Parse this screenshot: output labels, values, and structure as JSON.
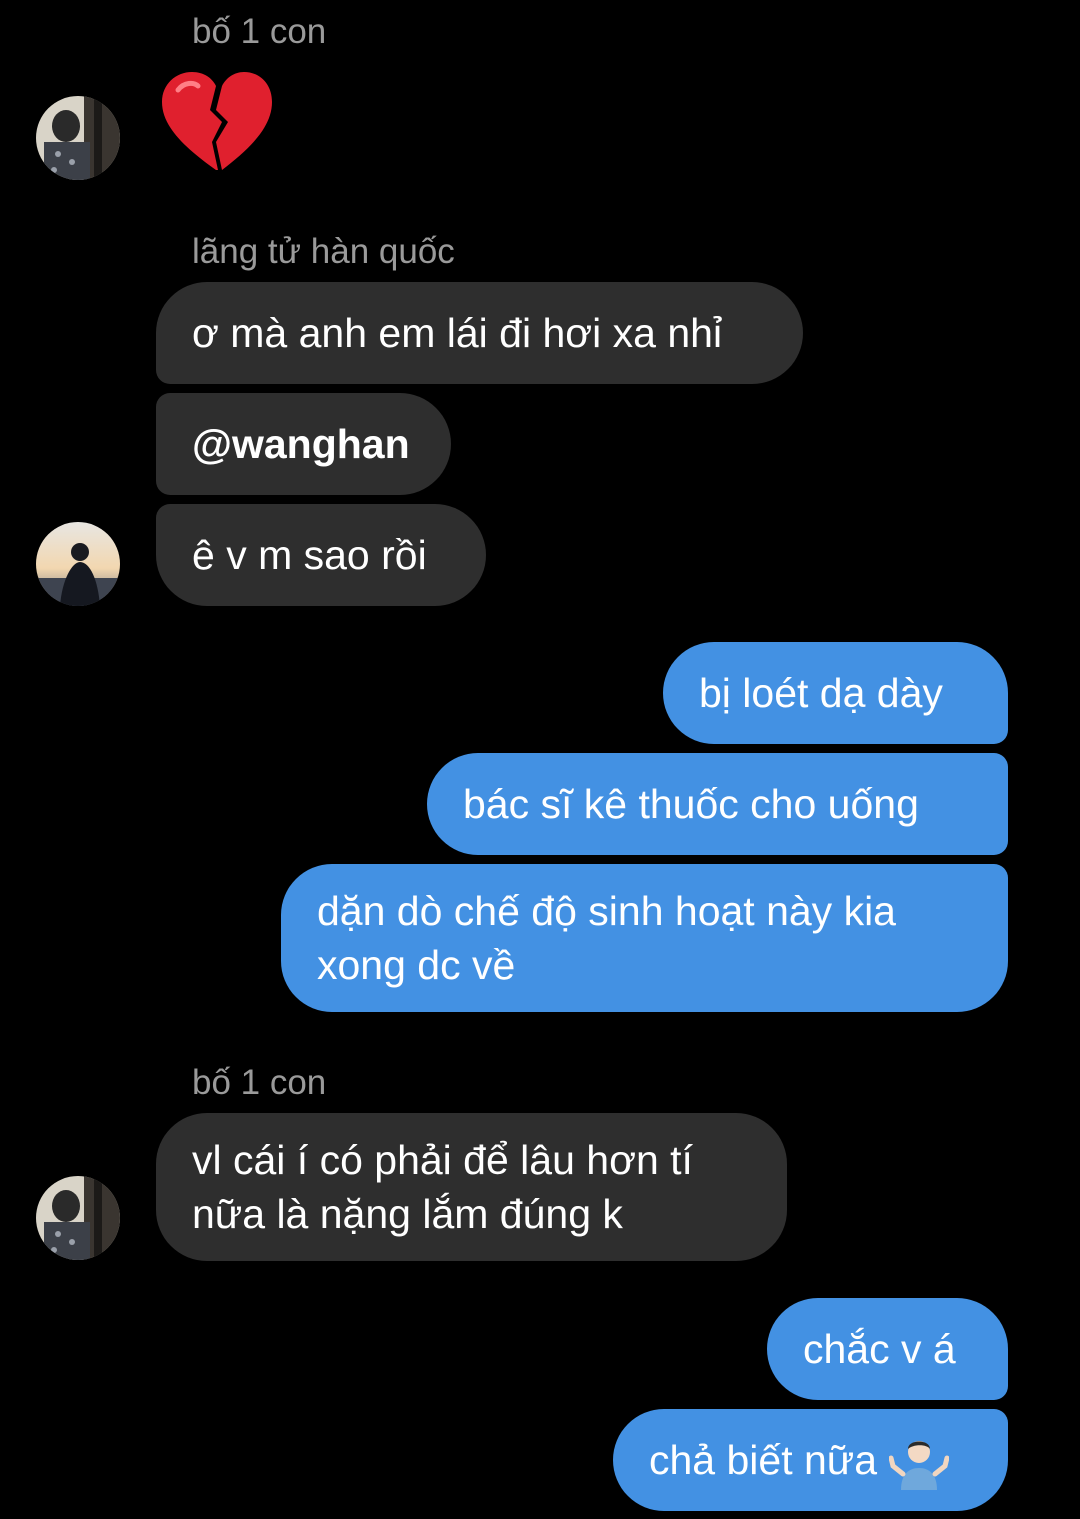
{
  "conversation": {
    "groups": [
      {
        "sender": "bố 1 con",
        "messages": [
          {
            "type": "emoji",
            "icon": "broken-heart-icon"
          }
        ]
      },
      {
        "sender": "lãng tử hàn quốc",
        "messages": [
          {
            "text": "ơ mà anh em lái đi hơi xa nhỉ"
          },
          {
            "text": "@wanghan"
          },
          {
            "text": "ê v m sao rồi"
          }
        ]
      },
      {
        "sender": "",
        "outgoing": true,
        "messages": [
          {
            "text": "bị loét dạ dày"
          },
          {
            "text": "bác sĩ kê thuốc cho uống"
          },
          {
            "line1": "dặn dò chế độ sinh hoạt này kia",
            "line2": "xong dc về"
          }
        ]
      },
      {
        "sender": "bố 1 con",
        "messages": [
          {
            "line1": "vl cái í có phải để lâu hơn tí",
            "line2": "nữa là nặng lắm đúng k"
          }
        ]
      },
      {
        "sender": "",
        "outgoing": true,
        "messages": [
          {
            "text": "chắc v á"
          },
          {
            "text": "chả biết nữa",
            "icon": "person-shrugging-icon"
          }
        ]
      }
    ]
  },
  "colors": {
    "background": "#000000",
    "incoming_bubble": "#2e2e2e",
    "outgoing_bubble": "#4391e3",
    "sender_name": "#9a9a9a"
  }
}
